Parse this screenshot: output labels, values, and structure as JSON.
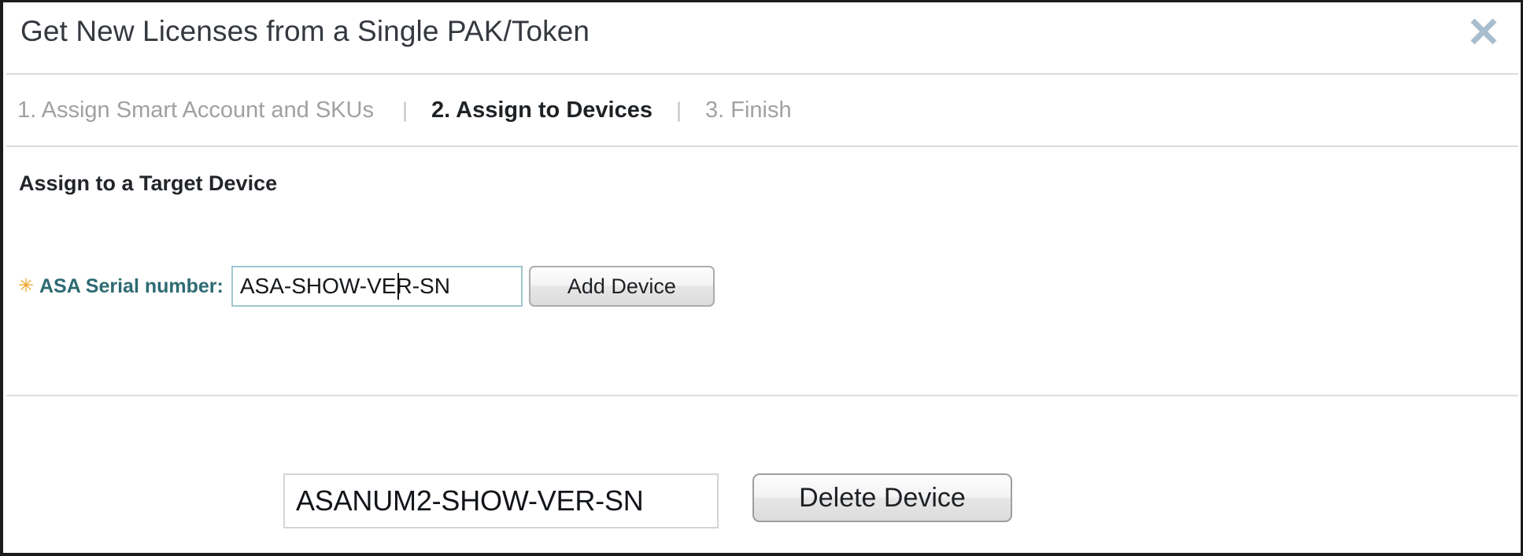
{
  "dialog": {
    "title": "Get New Licenses from a Single PAK/Token",
    "close_icon": "close-icon",
    "close_color": "#a8bdcd"
  },
  "steps": {
    "separator": "|",
    "items": [
      {
        "label": "1. Assign Smart Account and SKUs",
        "active": false
      },
      {
        "label": "2. Assign to Devices",
        "active": true
      },
      {
        "label": "3. Finish",
        "active": false
      }
    ]
  },
  "main": {
    "section_heading": "Assign to a Target Device",
    "required_marker": "✳",
    "required_marker_color": "#f0a125",
    "serial_label": "ASA Serial number:",
    "serial_label_color": "#2d6b72",
    "serial_value": "ASA-SHOW-VER-SN",
    "serial_placeholder": "Serial number",
    "add_device_label": "Add Device"
  },
  "device_list": {
    "entries": [
      {
        "serial": "ASANUM2-SHOW-VER-SN"
      }
    ],
    "delete_device_label": "Delete Device"
  }
}
